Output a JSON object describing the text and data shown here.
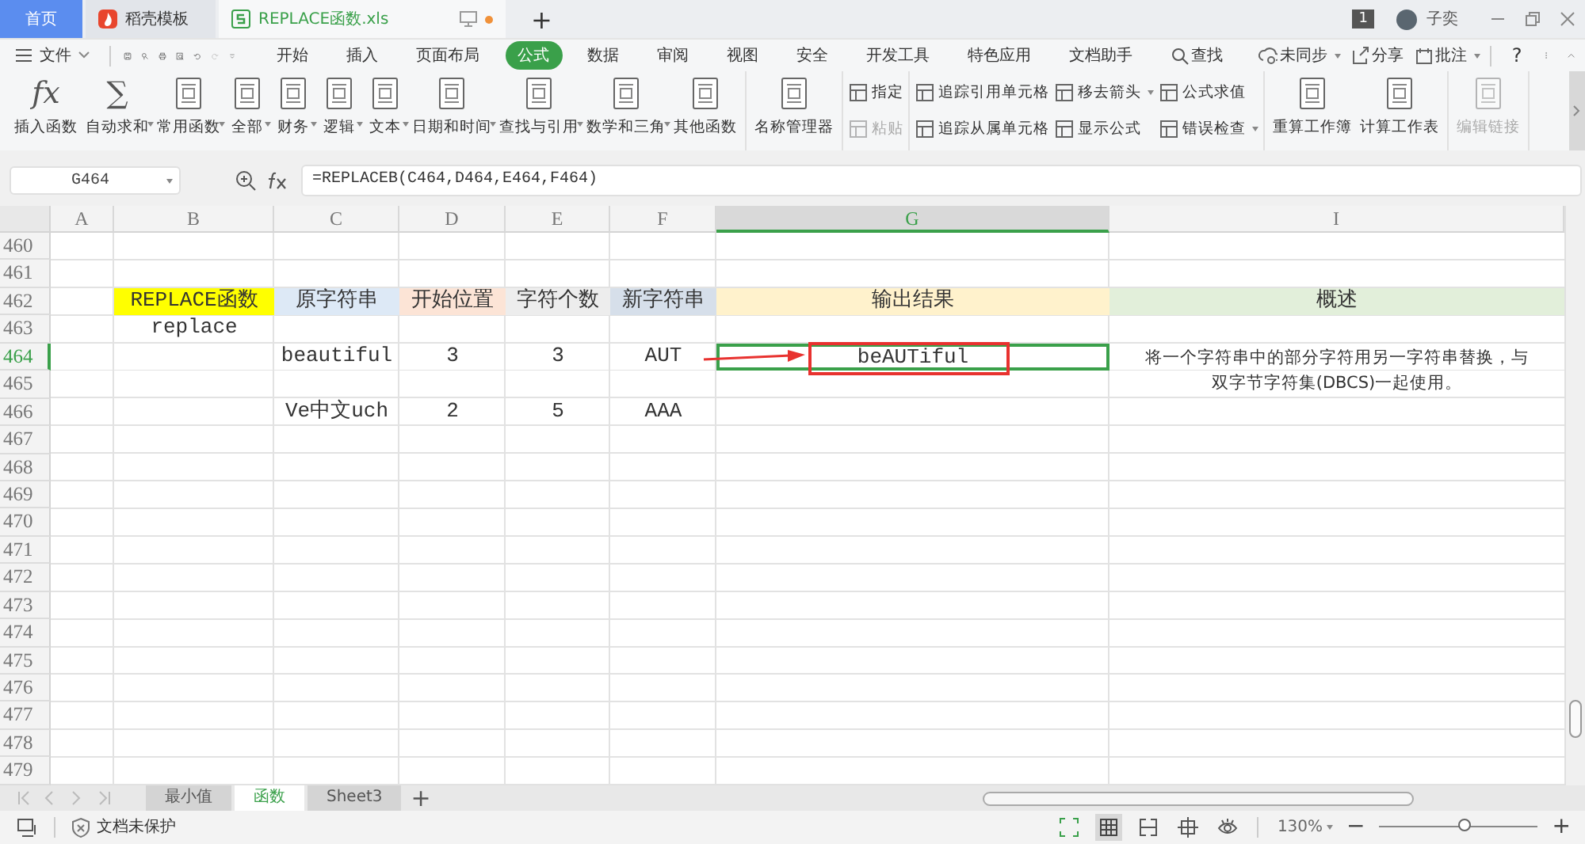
{
  "tabs": [
    {
      "label": "首页",
      "selected": false,
      "kind": "home",
      "modified": false
    },
    {
      "label": "稻壳模板",
      "selected": false,
      "kind": "docer",
      "modified": false
    },
    {
      "label": "REPLACE函数.xls",
      "selected": true,
      "kind": "file",
      "modified": true
    }
  ],
  "new_tab": "+",
  "account": {
    "badge": "1",
    "user": "子奕"
  },
  "menu": {
    "file": "文件",
    "items": [
      {
        "label": "开始",
        "selected": false
      },
      {
        "label": "插入",
        "selected": false
      },
      {
        "label": "页面布局",
        "selected": false
      },
      {
        "label": "公式",
        "selected": true
      },
      {
        "label": "数据",
        "selected": false
      },
      {
        "label": "审阅",
        "selected": false
      },
      {
        "label": "视图",
        "selected": false
      },
      {
        "label": "安全",
        "selected": false
      },
      {
        "label": "开发工具",
        "selected": false
      },
      {
        "label": "特色应用",
        "selected": false
      },
      {
        "label": "文档助手",
        "selected": false
      }
    ],
    "search": "查找",
    "actions": [
      {
        "label": "未同步",
        "dropdown": true
      },
      {
        "label": "分享",
        "dropdown": false
      },
      {
        "label": "批注",
        "dropdown": true
      }
    ],
    "help": "?"
  },
  "ribbon": {
    "groups": [
      {
        "kind": "big",
        "items": [
          {
            "label": "插入函数",
            "glyph": "fx",
            "dropdown": false,
            "disabled": false
          },
          {
            "label": "自动求和",
            "glyph": "∑",
            "dropdown": true,
            "disabled": false
          },
          {
            "label": "常用函数",
            "dropdown": true,
            "disabled": false
          },
          {
            "label": "全部",
            "dropdown": true,
            "disabled": false
          },
          {
            "label": "财务",
            "dropdown": true,
            "disabled": false
          },
          {
            "label": "逻辑",
            "dropdown": true,
            "disabled": false
          },
          {
            "label": "文本",
            "dropdown": true,
            "disabled": false
          },
          {
            "label": "日期和时间",
            "dropdown": true,
            "disabled": false
          },
          {
            "label": "查找与引用",
            "dropdown": true,
            "disabled": false
          },
          {
            "label": "数学和三角",
            "dropdown": true,
            "disabled": false
          },
          {
            "label": "其他函数",
            "dropdown": false,
            "disabled": false
          }
        ]
      },
      {
        "kind": "big",
        "items": [
          {
            "label": "名称管理器",
            "dropdown": false,
            "disabled": false
          }
        ]
      },
      {
        "kind": "stack",
        "items": [
          {
            "label": "指定",
            "dropdown": false,
            "disabled": false
          },
          {
            "label": "粘贴",
            "dropdown": false,
            "disabled": true
          }
        ]
      },
      {
        "kind": "stack",
        "items": [
          {
            "label": "追踪引用单元格",
            "dropdown": false,
            "disabled": false
          },
          {
            "label": "追踪从属单元格",
            "dropdown": false,
            "disabled": false
          },
          {
            "label": "移去箭头",
            "dropdown": true,
            "disabled": false
          },
          {
            "label": "显示公式",
            "dropdown": false,
            "disabled": false
          },
          {
            "label": "公式求值",
            "dropdown": false,
            "disabled": false
          },
          {
            "label": "错误检查",
            "dropdown": true,
            "disabled": false
          }
        ]
      },
      {
        "kind": "big",
        "items": [
          {
            "label": "重算工作簿",
            "dropdown": false,
            "disabled": false
          },
          {
            "label": "计算工作表",
            "dropdown": false,
            "disabled": false
          }
        ]
      },
      {
        "kind": "big",
        "items": [
          {
            "label": "编辑链接",
            "dropdown": false,
            "disabled": true
          }
        ]
      }
    ]
  },
  "formula_bar": {
    "name_box": "G464",
    "formula": "=REPLACEB(C464,D464,E464,F464)"
  },
  "columns": [
    {
      "label": "A",
      "selected": false
    },
    {
      "label": "B",
      "selected": false
    },
    {
      "label": "C",
      "selected": false
    },
    {
      "label": "D",
      "selected": false
    },
    {
      "label": "E",
      "selected": false
    },
    {
      "label": "F",
      "selected": false
    },
    {
      "label": "G",
      "selected": true
    },
    {
      "label": "I",
      "selected": false
    }
  ],
  "rows": [
    {
      "label": "460",
      "selected": false
    },
    {
      "label": "461",
      "selected": false
    },
    {
      "label": "462",
      "selected": false,
      "cells": [
        null,
        {
          "text": "REPLACE函数",
          "color": "#ffff00"
        },
        {
          "text": "原字符串",
          "color": "#dde9f6"
        },
        {
          "text": "开始位置",
          "color": "#fce4d6"
        },
        {
          "text": "字符个数",
          "color": "#ededed"
        },
        {
          "text": "新字符串",
          "color": "#d6dfea"
        },
        {
          "text": "输出结果",
          "color": "#fff2cc"
        },
        {
          "text": "概述",
          "color": "#e2efda"
        }
      ]
    },
    {
      "label": "463",
      "selected": false,
      "cells": [
        null,
        {
          "text": "replace"
        }
      ]
    },
    {
      "label": "464",
      "selected": true,
      "cells": [
        null,
        null,
        {
          "text": "beautiful"
        },
        {
          "text": "3"
        },
        {
          "text": "3"
        },
        {
          "text": "AUT"
        },
        {
          "text": "beAUTiful"
        },
        {
          "text": "将一个字符串中的部分字符用另一字符串替换，与双字节字符集(DBCS)一起使用。",
          "kind": "tall"
        }
      ]
    },
    {
      "label": "465",
      "selected": false
    },
    {
      "label": "466",
      "selected": false,
      "cells": [
        null,
        null,
        {
          "text": "Ve中文uch"
        },
        {
          "text": "2"
        },
        {
          "text": "5"
        },
        {
          "text": "AAA"
        }
      ]
    },
    {
      "label": "467",
      "selected": false
    },
    {
      "label": "468",
      "selected": false
    },
    {
      "label": "469",
      "selected": false
    },
    {
      "label": "470",
      "selected": false
    },
    {
      "label": "471",
      "selected": false
    },
    {
      "label": "472",
      "selected": false
    },
    {
      "label": "473",
      "selected": false
    },
    {
      "label": "474",
      "selected": false
    },
    {
      "label": "475",
      "selected": false
    },
    {
      "label": "476",
      "selected": false
    },
    {
      "label": "477",
      "selected": false
    },
    {
      "label": "478",
      "selected": false
    },
    {
      "label": "479",
      "selected": false
    }
  ],
  "annotations": {
    "arrow": true,
    "frame": true
  },
  "sheet_tabs": [
    {
      "label": "最小值",
      "selected": false
    },
    {
      "label": "函数",
      "selected": true
    },
    {
      "label": "Sheet3",
      "selected": false
    }
  ],
  "add_sheet": "+",
  "status_bar": {
    "protection": "文档未保护",
    "zoom": "130%",
    "zoom_out": "−",
    "zoom_in": "+",
    "zoom_slider": {
      "level": 0.55
    }
  }
}
